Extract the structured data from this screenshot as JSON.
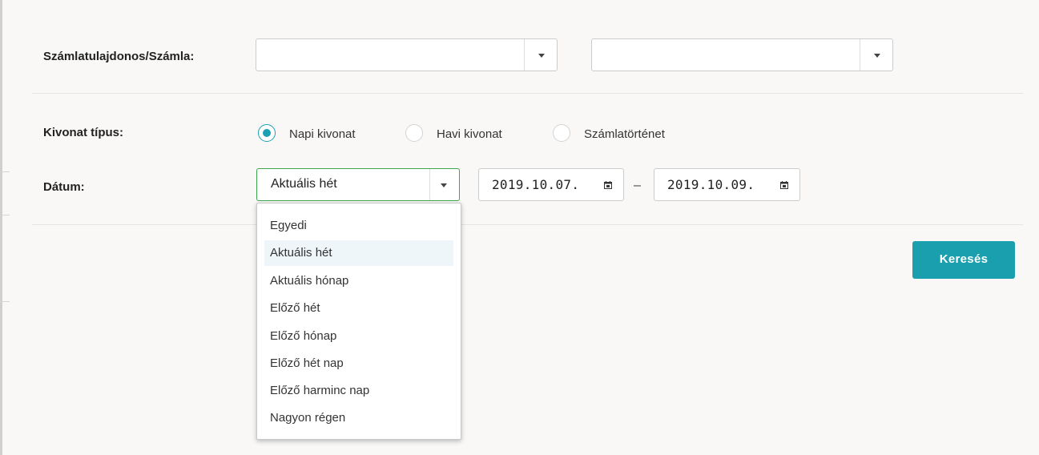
{
  "account": {
    "label": "Számlatulajdonos/Számla:",
    "select1_value": "",
    "select2_value": ""
  },
  "statement_type": {
    "label": "Kivonat típus:",
    "options": [
      "Napi kivonat",
      "Havi kivonat",
      "Számlatörténet"
    ],
    "selected": "Napi kivonat"
  },
  "date": {
    "label": "Dátum:",
    "period_value": "Aktuális hét",
    "from": "2019.10.07.",
    "separator": "–",
    "to": "2019.10.09."
  },
  "period_dropdown": {
    "options": [
      "Egyedi",
      "Aktuális hét",
      "Aktuális hónap",
      "Előző hét",
      "Előző hónap",
      "Előző hét nap",
      "Előző harminc nap",
      "Nagyon régen"
    ],
    "highlighted": "Aktuális hét"
  },
  "search_button": "Keresés",
  "icons": {
    "select_caret": "chevron-down-icon",
    "date_picker": "calendar-icon"
  },
  "colors": {
    "accent": "#1a9fae",
    "focus_border": "#3aa64e",
    "highlight": "#eef6f9"
  }
}
